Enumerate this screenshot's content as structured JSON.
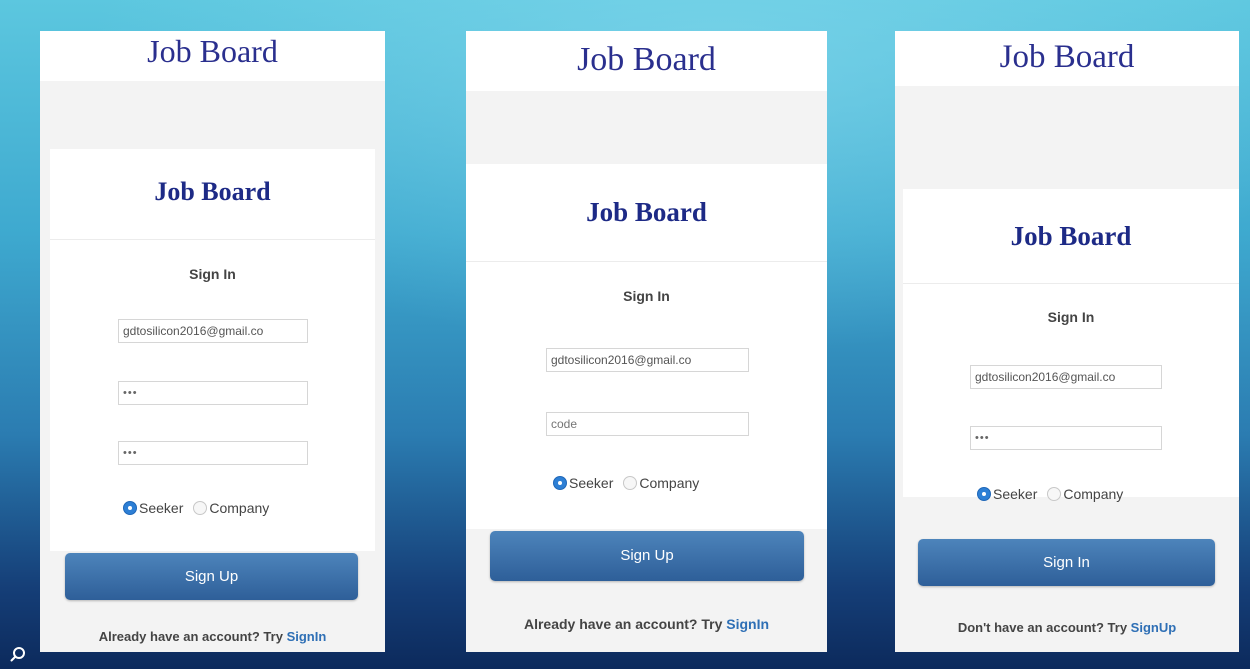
{
  "screens": [
    {
      "top_title": "Job Board",
      "brand": "Job Board",
      "signin_label": "Sign In",
      "fields": [
        {
          "value": "gdtosilicon2016@gmail.co",
          "type": "email"
        },
        {
          "value": "•••",
          "type": "password"
        },
        {
          "value": "•••",
          "type": "password"
        }
      ],
      "radios": [
        {
          "label": "Seeker",
          "checked": true
        },
        {
          "label": "Company",
          "checked": false
        }
      ],
      "button_label": "Sign Up",
      "footer_prefix": "Already have an account? Try ",
      "footer_link": "SignIn"
    },
    {
      "top_title": "Job Board",
      "brand": "Job Board",
      "signin_label": "Sign In",
      "fields": [
        {
          "value": "gdtosilicon2016@gmail.co",
          "type": "email"
        },
        {
          "placeholder": "code",
          "type": "text"
        }
      ],
      "radios": [
        {
          "label": "Seeker",
          "checked": true
        },
        {
          "label": "Company",
          "checked": false
        }
      ],
      "button_label": "Sign Up",
      "footer_prefix": "Already have an account? Try ",
      "footer_link": "SignIn"
    },
    {
      "top_title": "Job Board",
      "brand": "Job Board",
      "signin_label": "Sign In",
      "fields": [
        {
          "value": "gdtosilicon2016@gmail.co",
          "type": "email"
        },
        {
          "value": "•••",
          "type": "password"
        }
      ],
      "radios": [
        {
          "label": "Seeker",
          "checked": true
        },
        {
          "label": "Company",
          "checked": false
        }
      ],
      "button_label": "Sign In",
      "footer_prefix": "Don't have an account? Try ",
      "footer_link": "SignUp"
    }
  ],
  "colors": {
    "brand_text": "#1d2a86",
    "button": "#3a6ea8",
    "link": "#2e6fb5",
    "radio_checked": "#2d7fd5"
  },
  "icons": {
    "corner": "search-icon"
  }
}
